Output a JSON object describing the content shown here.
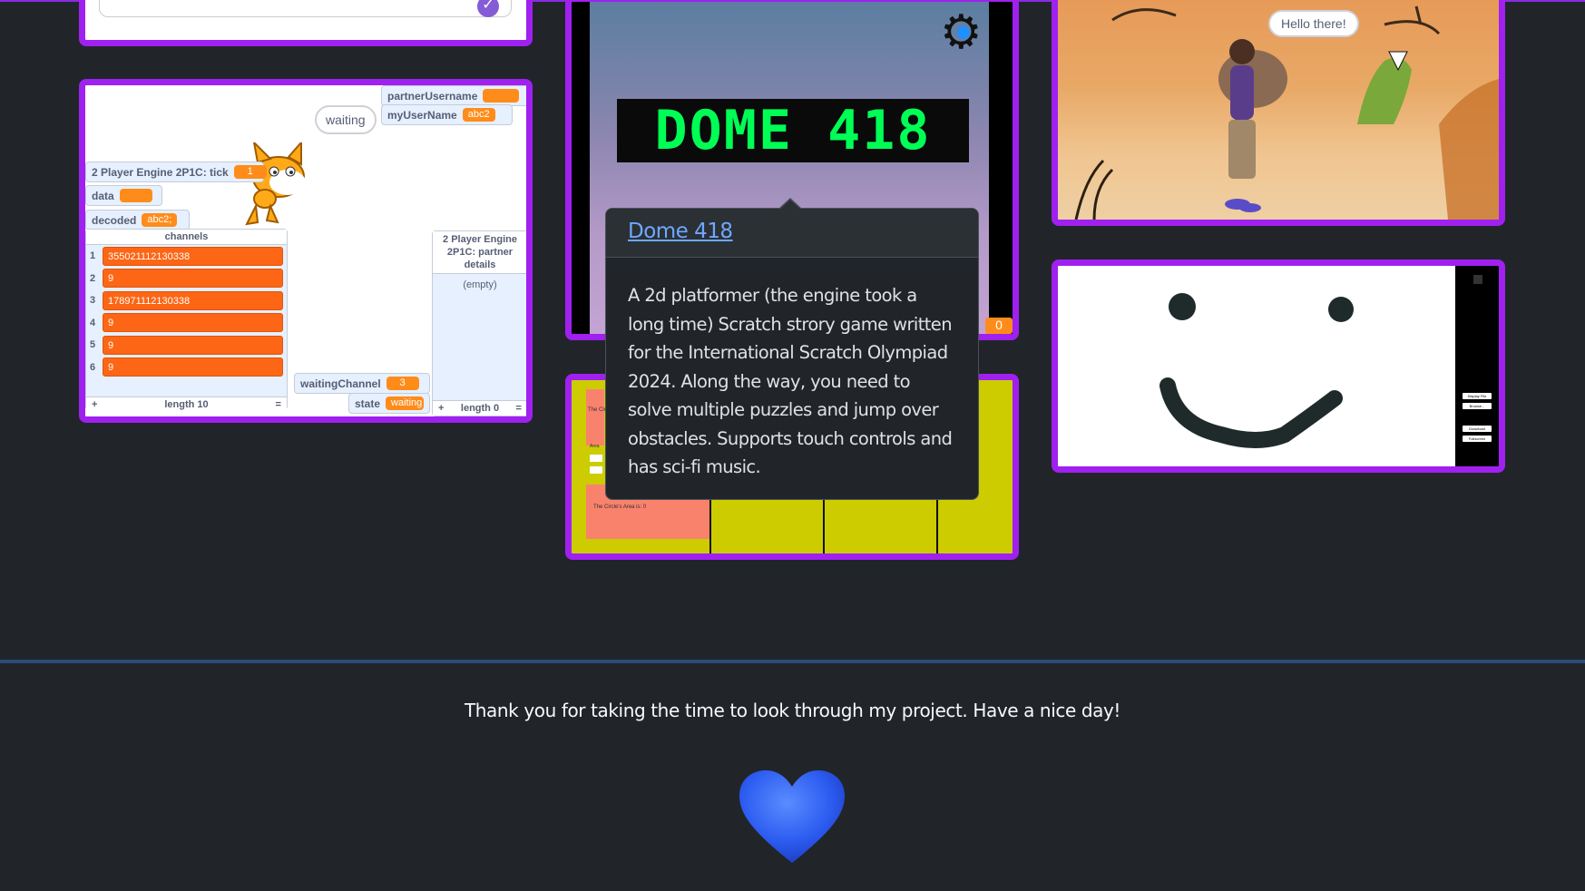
{
  "chat_card": {
    "check_icon": "check-circle-icon"
  },
  "multiplayer_card": {
    "monitors": {
      "partner_username": {
        "label": "partnerUsername",
        "value": ""
      },
      "my_user_name": {
        "label": "myUserName",
        "value": "abc2"
      },
      "engine_tick": {
        "label": "2 Player Engine 2P1C: tick",
        "value": "1"
      },
      "data": {
        "label": "data",
        "value": ""
      },
      "decoded": {
        "label": "decoded",
        "value": "abc2;"
      },
      "waiting_channel": {
        "label": "waitingChannel",
        "value": "3"
      },
      "state": {
        "label": "state",
        "value": "waiting"
      }
    },
    "bubble": "waiting",
    "channels_list": {
      "title": "channels",
      "rows": [
        {
          "index": "1",
          "value": "355021112130338"
        },
        {
          "index": "2",
          "value": "9"
        },
        {
          "index": "3",
          "value": "178971112130338"
        },
        {
          "index": "4",
          "value": "9"
        },
        {
          "index": "5",
          "value": "9"
        },
        {
          "index": "6",
          "value": "9"
        }
      ],
      "add": "+",
      "length": "length 10",
      "resize": "="
    },
    "partner_list": {
      "title": "2 Player Engine 2P1C: partner details",
      "empty": "(empty)",
      "add": "+",
      "length": "length 0",
      "resize": "="
    }
  },
  "dome_card": {
    "logo_text": "DOME 418",
    "score": "0",
    "gear_icon": "gear-icon"
  },
  "popover": {
    "title": "Dome 418",
    "body": "A 2d platformer (the engine took a long time) Scratch strory game written for the International Scratch Olympiad 2024. Along the way, you need to solve multiple puzzles and jump over obstacles. Supports touch controls and has sci-fi music."
  },
  "circle_card": {
    "area_label": "The Circle's Area is: 0",
    "top_label": "The Circle",
    "small_label": "Area"
  },
  "savanna_card": {
    "bubble": "Hello there!"
  },
  "paint_card": {
    "buttons": [
      "Display File",
      "Browse...",
      "Download",
      "Fullscreen"
    ]
  },
  "footer": {
    "thanks": "Thank you for taking the time to look through my project. Have a nice day!",
    "heart_icon": "blue-heart-icon"
  },
  "colors": {
    "background": "#212529",
    "card_border": "#a020f0",
    "accent": "#6ea8fe",
    "scratch_orange": "#ff8c1a",
    "dome_green": "#00ff55",
    "circle_yellow": "#cccc00"
  }
}
